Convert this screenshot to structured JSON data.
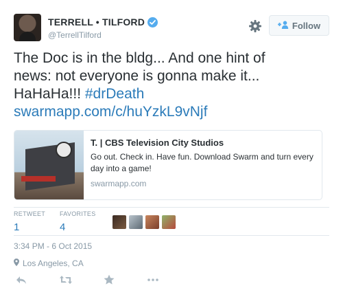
{
  "user": {
    "display_name": "TERRELL • TILFORD",
    "handle": "@TerrellTilford",
    "verified_icon": "verified-badge-icon"
  },
  "follow_button": {
    "label": "Follow",
    "icon": "add-person-icon"
  },
  "settings_icon": "gear-icon",
  "tweet": {
    "line1": "The Doc is in the bldg... And one hint of",
    "line2": "news: not everyone is gonna make it...",
    "line3_text": "HaHaHa!!! ",
    "hashtag": "#drDeath",
    "link": "swarmapp.com/c/huYzkL9vNjf"
  },
  "card": {
    "title": "T. | CBS Television City Studios",
    "description": "Go out. Check in. Have fun. Download Swarm and turn every day into a game!",
    "domain": "swarmapp.com"
  },
  "stats": {
    "retweets_label": "RETWEET",
    "retweets_value": "1",
    "favorites_label": "FAVORITES",
    "favorites_value": "4"
  },
  "timestamp": "3:34 PM - 6 Oct 2015",
  "location": "Los Angeles, CA",
  "actions": [
    "reply-icon",
    "retweet-icon",
    "favorite-icon",
    "more-icon"
  ],
  "colors": {
    "link": "#2b7bb9",
    "verified": "#55acee",
    "muted": "#8899a6"
  }
}
